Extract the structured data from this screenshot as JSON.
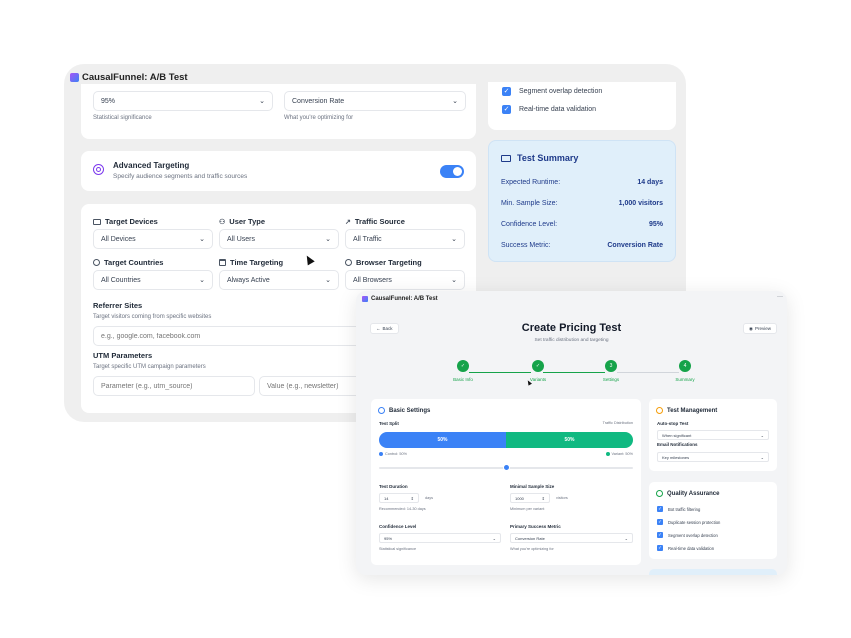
{
  "back_window": {
    "title": "CausalFunnel: A/B Test",
    "top_card": {
      "confidence_value": "95%",
      "confidence_caption": "Statistical significance",
      "metric_value": "Conversion Rate",
      "metric_caption": "What you're optimizing for"
    },
    "advanced": {
      "title": "Advanced Targeting",
      "subtitle": "Specify audience segments and traffic sources",
      "toggle_on": true
    },
    "targeting": {
      "fields": [
        {
          "label": "Target Devices",
          "value": "All Devices",
          "icon": "monitor-icon"
        },
        {
          "label": "User Type",
          "value": "All Users",
          "icon": "user-icon"
        },
        {
          "label": "Traffic Source",
          "value": "All Traffic",
          "icon": "trend-icon"
        },
        {
          "label": "Target Countries",
          "value": "All Countries",
          "icon": "globe-icon"
        },
        {
          "label": "Time Targeting",
          "value": "Always Active",
          "icon": "calendar-icon"
        },
        {
          "label": "Browser Targeting",
          "value": "All Browsers",
          "icon": "browser-icon"
        }
      ],
      "referrer_label": "Referrer Sites",
      "referrer_caption": "Target visitors coming from specific websites",
      "referrer_placeholder": "e.g., google.com, facebook.com",
      "utm_label": "UTM Parameters",
      "utm_caption": "Target specific UTM campaign parameters",
      "utm_param_placeholder": "Parameter (e.g., utm_source)",
      "utm_value_placeholder": "Value (e.g., newsletter)"
    },
    "checks": [
      "Segment overlap detection",
      "Real-time data validation"
    ],
    "summary": {
      "title": "Test Summary",
      "rows": [
        {
          "label": "Expected Runtime:",
          "value": "14 days"
        },
        {
          "label": "Min. Sample Size:",
          "value": "1,000 visitors"
        },
        {
          "label": "Confidence Level:",
          "value": "95%"
        },
        {
          "label": "Success Metric:",
          "value": "Conversion Rate"
        }
      ]
    }
  },
  "front_window": {
    "title": "CausalFunnel: A/B Test",
    "menu_glyph": "···",
    "back_label": "Back",
    "preview_label": "Preview",
    "heading": "Create Pricing Test",
    "subheading": "Set traffic distribution and targeting",
    "steps": [
      {
        "label": "Basic Info",
        "mark": "✓"
      },
      {
        "label": "Variants",
        "mark": "✓"
      },
      {
        "label": "Settings",
        "mark": "3"
      },
      {
        "label": "Summary",
        "mark": "4"
      }
    ],
    "basic": {
      "title": "Basic Settings",
      "split_label": "Test Split",
      "split_right_label": "Traffic Distribution",
      "control_pct": "50%",
      "variant_pct": "50%",
      "control_fraction": 0.5,
      "control_legend": "Control: 50%",
      "variant_legend": "Variant: 50%",
      "duration_label": "Test Duration",
      "duration_value": "14",
      "duration_unit": "days",
      "duration_caption": "Recommended: 14-30 days",
      "sample_label": "Minimal Sample Size",
      "sample_value": "1000",
      "sample_unit": "visitors",
      "sample_caption": "Minimum per variant",
      "confidence_label": "Confidence Level",
      "confidence_value": "95%",
      "confidence_caption": "Statistical significance",
      "metric_label": "Primary Success Metric",
      "metric_value": "Conversion Rate",
      "metric_caption": "What you're optimizing for"
    },
    "management": {
      "title": "Test Management",
      "autostop_label": "Auto-stop Test",
      "autostop_value": "When significant",
      "email_label": "Email Notifications",
      "email_value": "Key milestones"
    },
    "quality": {
      "title": "Quality Assurance",
      "items": [
        "Bot traffic filtering",
        "Duplicate session protection",
        "Segment overlap detection",
        "Real-time data validation"
      ]
    }
  },
  "colors": {
    "accent_blue": "#3b82f6",
    "accent_green": "#16a34a",
    "summary_bg": "#e0effa"
  }
}
